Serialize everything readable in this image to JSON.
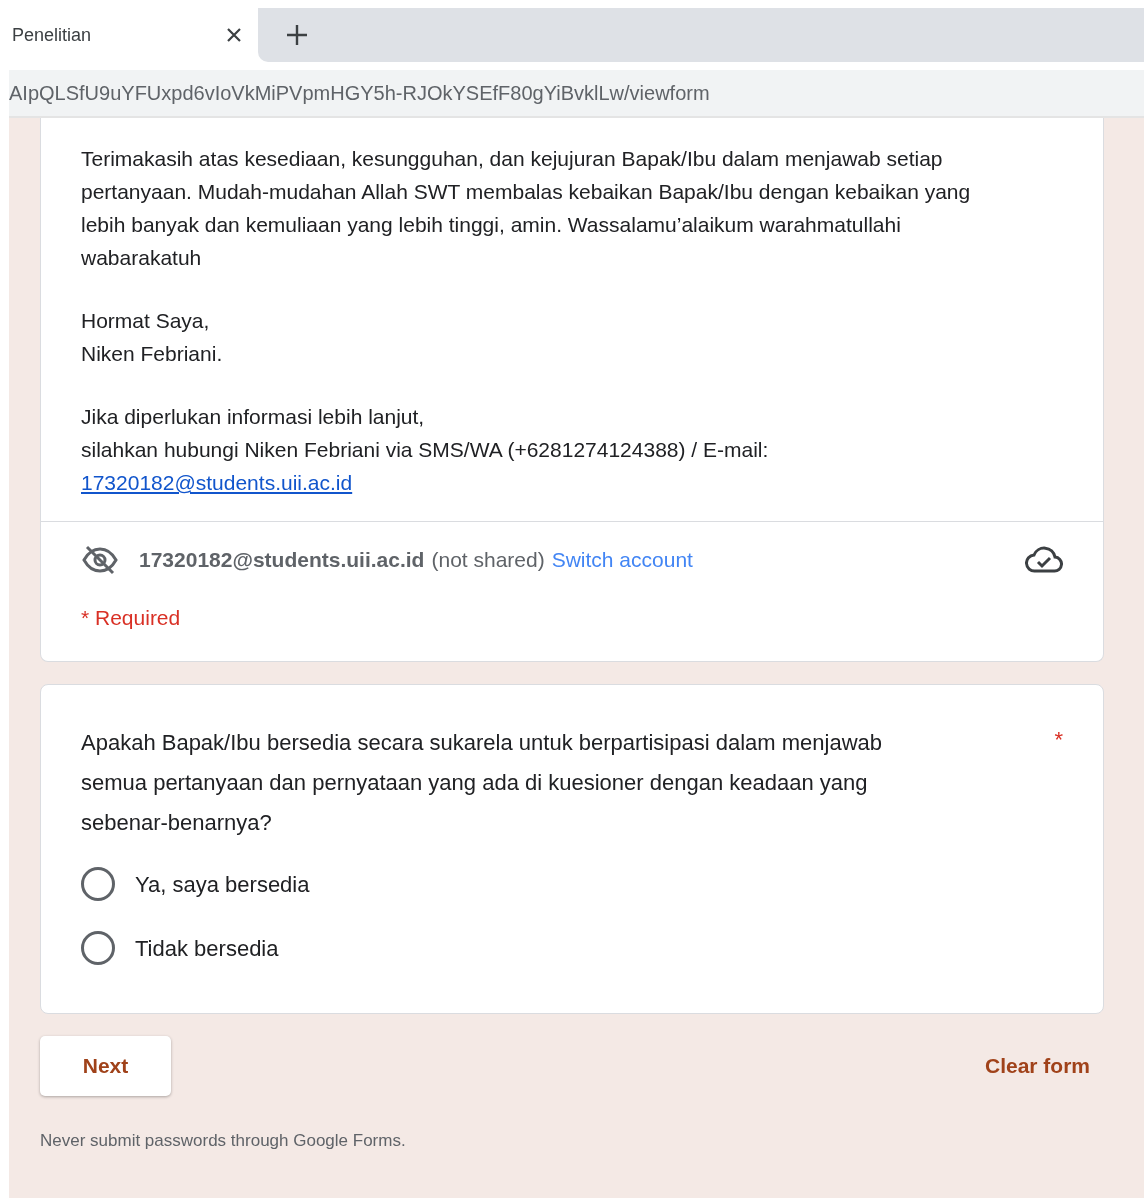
{
  "browser": {
    "tab": {
      "title": "Penelitian",
      "selected": true
    },
    "address": "AIpQLSfU9uYFUxpd6vIoVkMiPVpmHGY5h-RJOkYSEfF80gYiBvklLw/viewform"
  },
  "intro": {
    "paragraph": "Terimakasih atas kesediaan, kesungguhan, dan kejujuran Bapak/Ibu dalam menjawab setiap pertanyaan. Mudah-mudahan Allah SWT membalas kebaikan Bapak/Ibu dengan kebaikan yang lebih banyak dan kemuliaan yang lebih tinggi, amin. Wassalamu’alaikum warahmatullahi wabarakatuh",
    "signature": [
      "Hormat Saya,",
      "Niken Febriani."
    ],
    "contact_intro": "Jika diperlukan informasi lebih lanjut,",
    "contact_text": "silahkan hubungi Niken Febriani via SMS/WA (+6281274124388) / E-mail:",
    "contact_email": "17320182@students.uii.ac.id"
  },
  "account": {
    "email": "17320182@students.uii.ac.id",
    "note": "(not shared)",
    "switch_link": "Switch account"
  },
  "required_note": "* Required",
  "question": {
    "text": "Apakah Bapak/Ibu bersedia secara sukarela untuk berpartisipasi dalam menjawab semua pertanyaan dan pernyataan yang ada di kuesioner dengan keadaan yang sebenar-benarnya?",
    "required_mark": "*",
    "options": [
      {
        "label": "Ya, saya bersedia",
        "selected": false
      },
      {
        "label": "Tidak bersedia",
        "selected": false
      }
    ]
  },
  "actions": {
    "next": "Next",
    "clear": "Clear form"
  },
  "footer": "Never submit passwords through Google Forms."
}
